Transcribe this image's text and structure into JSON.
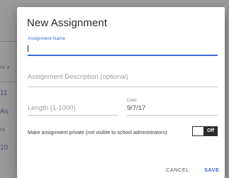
{
  "background": {
    "fragments": [
      "ns a",
      "11",
      "As",
      "ns",
      "10"
    ]
  },
  "dialog": {
    "title": "New Assignment",
    "name_field": {
      "label": "Assignment Name",
      "value": ""
    },
    "description_field": {
      "placeholder": "Assignment Description (optional)"
    },
    "length_field": {
      "placeholder": "Length (1-1000)"
    },
    "date_field": {
      "label": "Date",
      "value": "9/7/17"
    },
    "private_toggle": {
      "label": "Make assignment private (not visible to school administrators)",
      "state": "Off"
    },
    "actions": {
      "cancel": "CANCEL",
      "save": "SAVE"
    }
  },
  "colors": {
    "accent": "#3f6bd3",
    "overlay": "#8c8c8c",
    "toggle": "#2b2b2b"
  }
}
